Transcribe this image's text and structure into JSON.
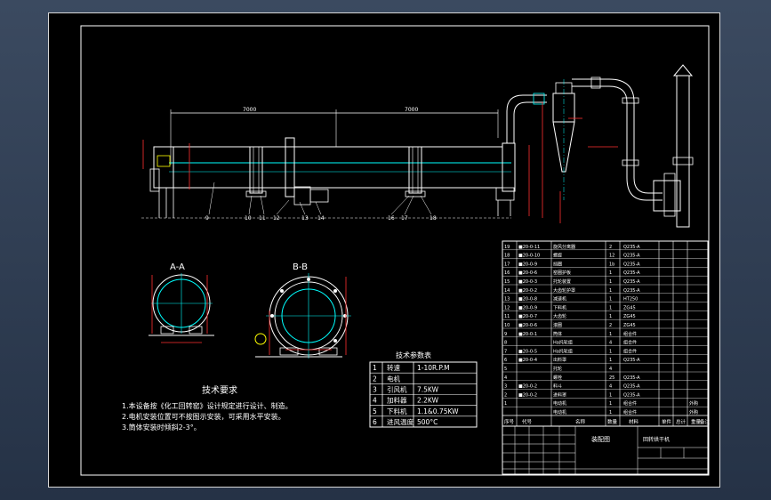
{
  "drawing": {
    "section_aa_title": "A-A",
    "section_bb_title": "B-B",
    "dim_len_left": "7000",
    "dim_len_right": "7000",
    "note_heading": "技术要求",
    "notes": [
      "1.本设备按《化工回转窑》设计规定进行设计、制造。",
      "2.电机安装位置可不按图示安装，可采用水平安装。",
      "3.筒体安装时倾斜2-3°。"
    ]
  },
  "params": {
    "title": "技术参数表",
    "rows": [
      [
        "1",
        "转速",
        "1-10R.P.M"
      ],
      [
        "2",
        "电机",
        ""
      ],
      [
        "3",
        "引风机",
        "7.5KW"
      ],
      [
        "4",
        "加料器",
        "2.2KW"
      ],
      [
        "5",
        "下料机",
        "1.1&0.75KW"
      ],
      [
        "6",
        "进风温度",
        "500°C"
      ]
    ]
  },
  "bom": {
    "rows": [
      [
        "19",
        "■20-0-11",
        "旋风分离器",
        "2",
        "Q235-A"
      ],
      [
        "18",
        "■20-0-10",
        "螺旋",
        "12",
        "Q235-A"
      ],
      [
        "17",
        "■20-0-9",
        "挡圈",
        "1b",
        "Q235-A"
      ],
      [
        "16",
        "■20-0-6",
        "窑圈护板",
        "1",
        "Q235-A"
      ],
      [
        "15",
        "■20-0-3",
        "托轮装置",
        "1",
        "Q235-A"
      ],
      [
        "14",
        "■20-0-2",
        "大齿轮护罩",
        "1",
        "Q235-A"
      ],
      [
        "13",
        "■20-0-8",
        "减速机",
        "1",
        "HT250"
      ],
      [
        "12",
        "■20-0-9",
        "下料机",
        "1",
        "ZG45"
      ],
      [
        "11",
        "■20-0-7",
        "大齿轮",
        "1",
        "ZG45"
      ],
      [
        "10",
        "■20-0-6",
        "滚圈",
        "2",
        "ZG45"
      ],
      [
        "9",
        "■20-0-1",
        "筒体",
        "1",
        "组合件"
      ],
      [
        "8",
        "",
        "Ha托轮组",
        "4",
        "组合件"
      ],
      [
        "7",
        "■20-0-5",
        "Ha托轮组",
        "1",
        "组合件"
      ],
      [
        "6",
        "■20-0-4",
        "出料罩",
        "1",
        "Q235-A"
      ],
      [
        "5",
        "",
        "托轮",
        "4",
        ""
      ],
      [
        "4",
        "",
        "螺栓",
        "25",
        "Q235-A"
      ],
      [
        "3",
        "■20-0-2",
        "料斗",
        "4",
        "Q235-A"
      ],
      [
        "2",
        "■20-0-2",
        "进料罩",
        "1",
        "Q235-A"
      ],
      [
        "1",
        "",
        "电动机",
        "1",
        "组合件",
        "外购"
      ],
      [
        "",
        "",
        "电动机",
        "1",
        "组合件",
        "外购"
      ]
    ],
    "header": [
      "序号",
      "代号",
      "名称",
      "数量",
      "材料",
      "单件",
      "总计",
      "重量",
      "备注"
    ]
  },
  "titleblock": {
    "drawing_name": "装配图",
    "right_label": "回转烘干机"
  }
}
